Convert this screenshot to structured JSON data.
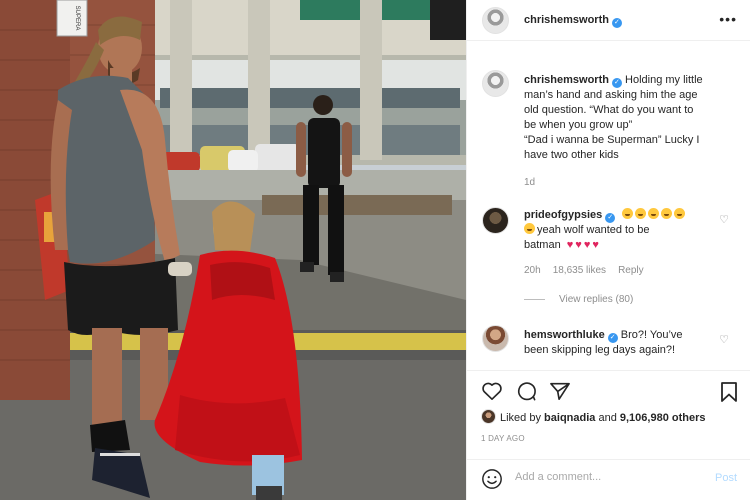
{
  "header": {
    "username": "chrishemsworth",
    "verified": true,
    "more_label": "•••"
  },
  "post": {
    "image_description_icon": "photo-icon",
    "sign_text": "SUPERA",
    "caption_user": "chrishemsworth",
    "caption_lines": [
      "Holding my little",
      "man’s hand and asking him the age",
      "old question. “What do you want to",
      "be when you grow up”",
      "“Dad i wanna be Superman” Lucky I",
      "have two other kids"
    ],
    "caption_age": "1d"
  },
  "comments": [
    {
      "user": "prideofgypsies",
      "verified": true,
      "text_line1_emoji_count": 5,
      "text_line2": "yeah wolf wanted to be",
      "text_line3": "batman",
      "heart_count": 4,
      "age": "20h",
      "likes": "18,635 likes",
      "reply": "Reply",
      "view_replies": "View replies (80)"
    },
    {
      "user": "hemsworthluke",
      "verified": true,
      "text_line1": "Bro?! You’ve",
      "text_line2": "been skipping leg days again?!"
    }
  ],
  "engagement": {
    "liked_by_prefix": "Liked by",
    "liked_by_user": "baiqnadia",
    "and_word": "and",
    "others": "9,106,980 others",
    "post_age": "1 DAY AGO"
  },
  "composer": {
    "placeholder": "Add a comment...",
    "post_label": "Post"
  },
  "colors": {
    "verified_blue": "#3897f0",
    "heart_red": "#e0245e",
    "cape_red": "#d4141a",
    "muted_text": "#8e8e8e",
    "post_disabled": "#b3dbff"
  }
}
